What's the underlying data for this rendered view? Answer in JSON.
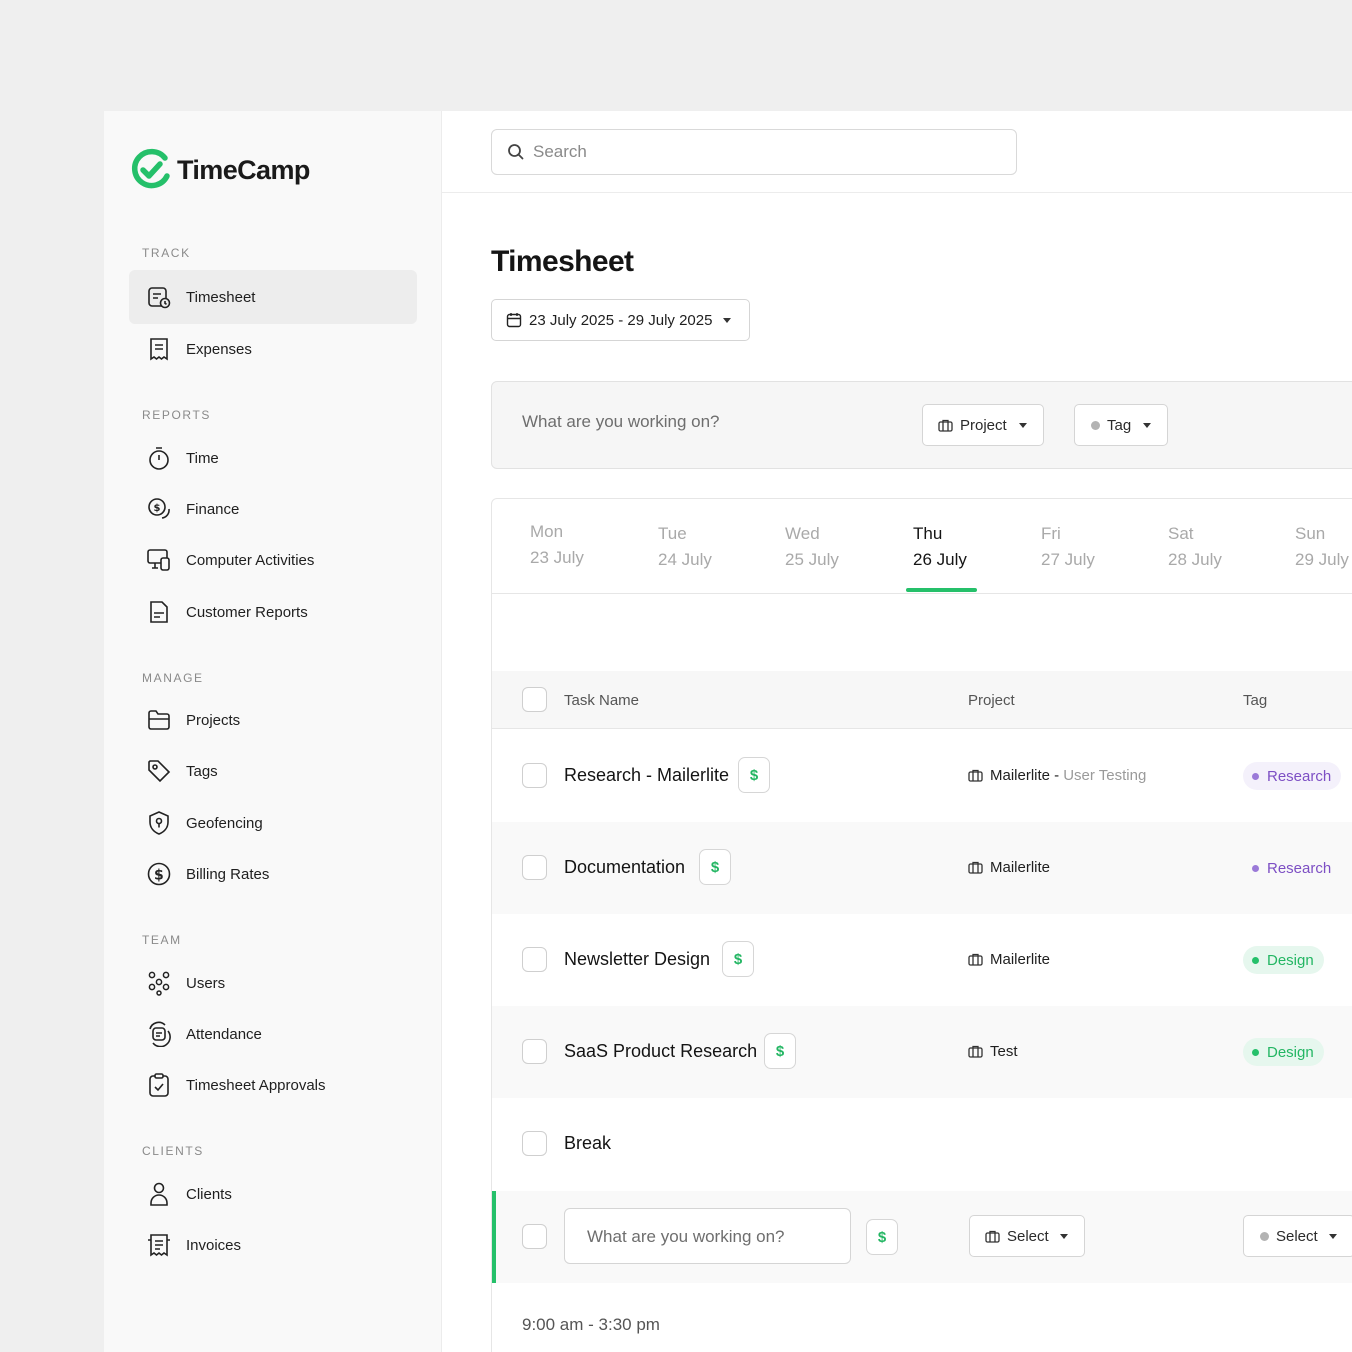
{
  "brand": {
    "name": "TimeCamp",
    "accent": "#25c06a"
  },
  "sidebar": {
    "sections": [
      {
        "label": "TRACK",
        "items": [
          {
            "label": "Timesheet",
            "icon": "timesheet-icon",
            "active": true
          },
          {
            "label": "Expenses",
            "icon": "receipt-icon"
          }
        ]
      },
      {
        "label": "REPORTS",
        "items": [
          {
            "label": "Time",
            "icon": "stopwatch-icon"
          },
          {
            "label": "Finance",
            "icon": "finance-icon"
          },
          {
            "label": "Computer Activities",
            "icon": "devices-icon"
          },
          {
            "label": "Customer Reports",
            "icon": "report-icon"
          }
        ]
      },
      {
        "label": "MANAGE",
        "items": [
          {
            "label": "Projects",
            "icon": "folder-icon"
          },
          {
            "label": "Tags",
            "icon": "tag-icon"
          },
          {
            "label": "Geofencing",
            "icon": "shield-pin-icon"
          },
          {
            "label": "Billing Rates",
            "icon": "dollar-circle-icon"
          }
        ]
      },
      {
        "label": "TEAM",
        "items": [
          {
            "label": "Users",
            "icon": "users-icon"
          },
          {
            "label": "Attendance",
            "icon": "attendance-icon"
          },
          {
            "label": "Timesheet Approvals",
            "icon": "clipboard-check-icon"
          }
        ]
      },
      {
        "label": "CLIENTS",
        "items": [
          {
            "label": "Clients",
            "icon": "person-icon"
          },
          {
            "label": "Invoices",
            "icon": "invoice-icon"
          }
        ]
      }
    ]
  },
  "search": {
    "placeholder": "Search"
  },
  "main": {
    "title": "Timesheet",
    "date_range": "23 July 2025 - 29 July 2025",
    "entry_bar": {
      "placeholder": "What are you working on?",
      "project_label": "Project",
      "tag_label": "Tag"
    },
    "days": [
      {
        "name": "Mon",
        "date": "23 July"
      },
      {
        "name": "Tue",
        "date": "24 July"
      },
      {
        "name": "Wed",
        "date": "25 July"
      },
      {
        "name": "Thu",
        "date": "26 July",
        "active": true
      },
      {
        "name": "Fri",
        "date": "27 July"
      },
      {
        "name": "Sat",
        "date": "28 July"
      },
      {
        "name": "Sun",
        "date": "29 July"
      }
    ],
    "table": {
      "columns": {
        "task": "Task Name",
        "project": "Project",
        "tag": "Tag"
      },
      "rows": [
        {
          "task": "Research - Mailerlite",
          "billable": "$",
          "project": "Mailerlite - ",
          "project_sub": "User Testing",
          "tag": "Research"
        },
        {
          "task": "Documentation",
          "billable": "$",
          "project": "Mailerlite",
          "tag": "Research"
        },
        {
          "task": "Newsletter Design",
          "billable": "$",
          "project": "Mailerlite",
          "tag": "Design"
        },
        {
          "task": "SaaS Product Research",
          "billable": "$",
          "project": "Test",
          "tag": "Design"
        },
        {
          "task": "Break"
        }
      ],
      "new_row": {
        "placeholder": "What are you working on?",
        "billable": "$",
        "project_select": "Select",
        "tag_select": "Select"
      }
    },
    "time_range": "9:00 am - 3:30 pm"
  },
  "colors": {
    "research_tag": "#7d4fc4",
    "research_bg": "#f4f1fb",
    "design_tag": "#23b663",
    "design_bg": "#e6f7ee"
  }
}
